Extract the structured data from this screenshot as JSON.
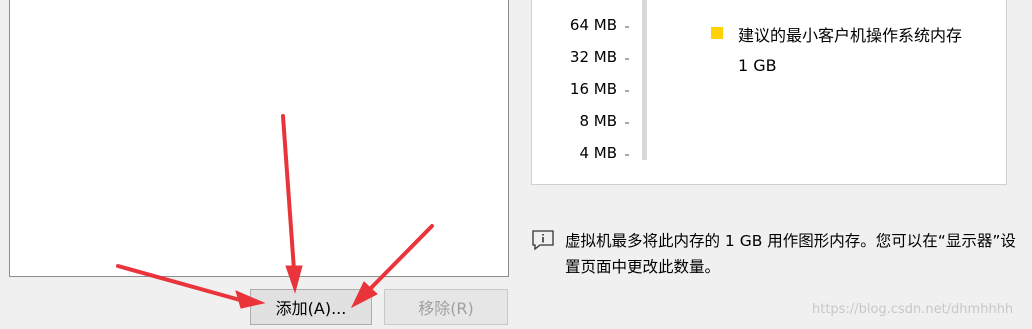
{
  "buttons": {
    "add_label": "添加(A)...",
    "remove_label": "移除(R)"
  },
  "memory": {
    "scale": [
      "64 MB",
      "32 MB",
      "16 MB",
      "8 MB",
      "4 MB"
    ],
    "legend_label": "建议的最小客户机操作系统内存",
    "legend_value": "1 GB",
    "legend_color": "#ffd200"
  },
  "info": {
    "text": "虚拟机最多将此内存的 1 GB 用作图形内存。您可以在“显示器”设置页面中更改此数量。"
  },
  "watermark": "https://blog.csdn.net/dhmhhhh",
  "annotation_color": "#e8343a"
}
